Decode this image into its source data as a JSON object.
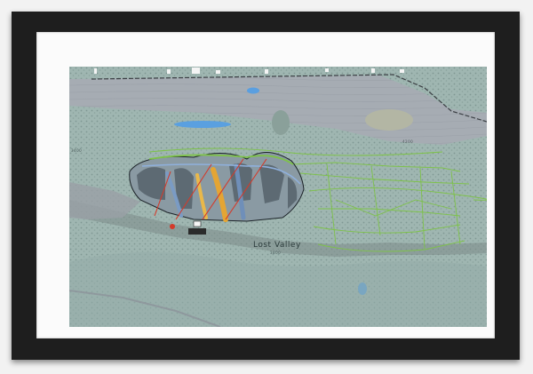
{
  "map": {
    "resort_name": "Lost Valley",
    "elevation_labels": {
      "upper": "4200",
      "mid": "3800",
      "left": "3400"
    }
  },
  "colors": {
    "frame": "#1e1e1e",
    "mat": "#fbfbfb",
    "terrain": "#9eb3b0",
    "plateau": "#a7adb3",
    "lake": "#5aa0e0",
    "trail_green": "#7ec24a",
    "run_orange": "#e4a534",
    "run_blue": "#6f8fb9"
  }
}
